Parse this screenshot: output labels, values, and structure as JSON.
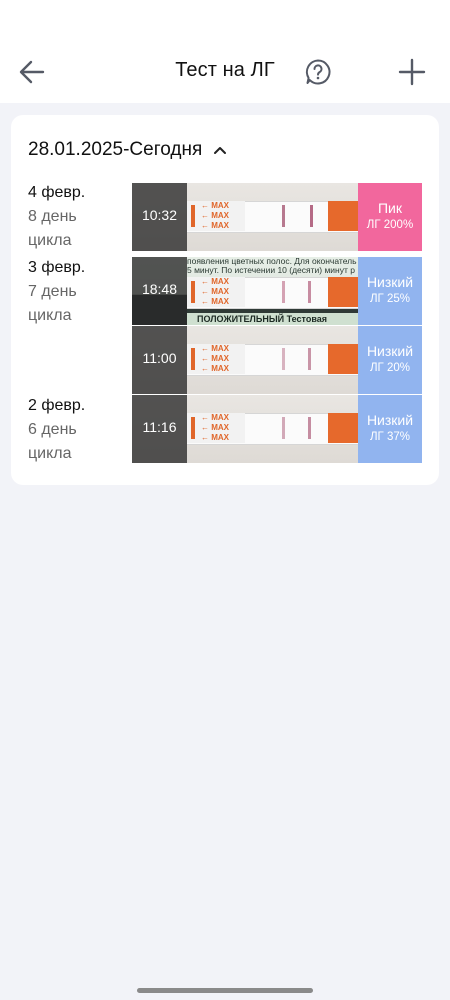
{
  "header": {
    "title": "Тест на ЛГ",
    "back_icon": "arrow-left-icon",
    "help_icon": "question-circle-icon",
    "add_icon": "plus-icon"
  },
  "range": {
    "label": "28.01.2025-Сегодня",
    "toggle_icon": "chevron-up-icon"
  },
  "days": [
    {
      "date": "4 февр.",
      "cycle_line1": "8 день",
      "cycle_line2": "цикла"
    },
    {
      "date": "3 февр.",
      "cycle_line1": "7 день",
      "cycle_line2": "цикла"
    },
    {
      "date": "2 февр.",
      "cycle_line1": "6 день",
      "cycle_line2": "цикла"
    }
  ],
  "entries": [
    {
      "time": "10:32",
      "level": "Пик",
      "lh": "ЛГ 200%",
      "color": "#f2679d"
    },
    {
      "time": "18:48",
      "level": "Низкий",
      "lh": "ЛГ 25%",
      "color": "#91b4ef",
      "photo_text_line1": "появления цветных полос. Для окончатель",
      "photo_text_line2": "5 минут. По истечении 10 (десяти) минут р",
      "photo_text_pos": "ПОЛОЖИТЕЛЬНЫЙ     Тестовая"
    },
    {
      "time": "11:00",
      "level": "Низкий",
      "lh": "ЛГ 20%",
      "color": "#91b4ef"
    },
    {
      "time": "11:16",
      "level": "Низкий",
      "lh": "ЛГ 37%",
      "color": "#91b4ef"
    }
  ],
  "strip_label": "← MAX"
}
